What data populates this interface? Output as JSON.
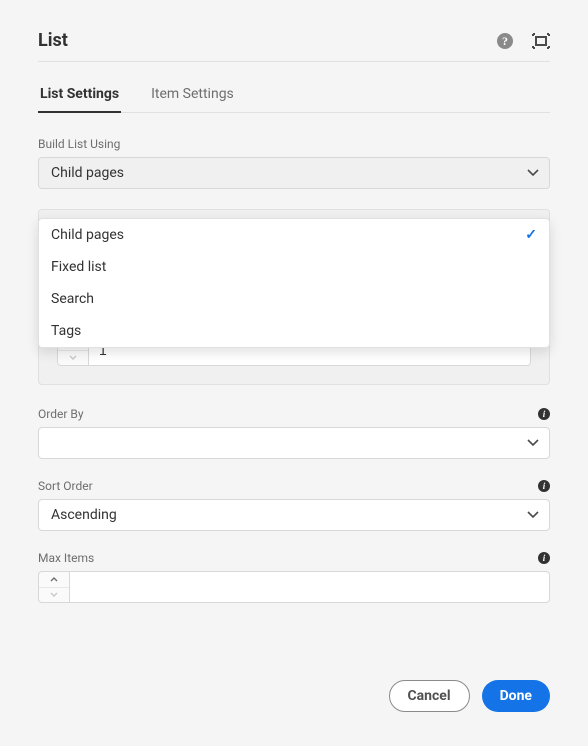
{
  "header": {
    "title": "List"
  },
  "tabs": [
    {
      "label": "List Settings",
      "active": true
    },
    {
      "label": "Item Settings",
      "active": false
    }
  ],
  "fields": {
    "build_list": {
      "label": "Build List Using",
      "value": "Child pages",
      "options": [
        "Child pages",
        "Fixed list",
        "Search",
        "Tags"
      ]
    },
    "depth": {
      "value": "1"
    },
    "order_by": {
      "label": "Order By",
      "value": ""
    },
    "sort_order": {
      "label": "Sort Order",
      "value": "Ascending"
    },
    "max_items": {
      "label": "Max Items",
      "value": ""
    }
  },
  "buttons": {
    "cancel": "Cancel",
    "done": "Done"
  }
}
